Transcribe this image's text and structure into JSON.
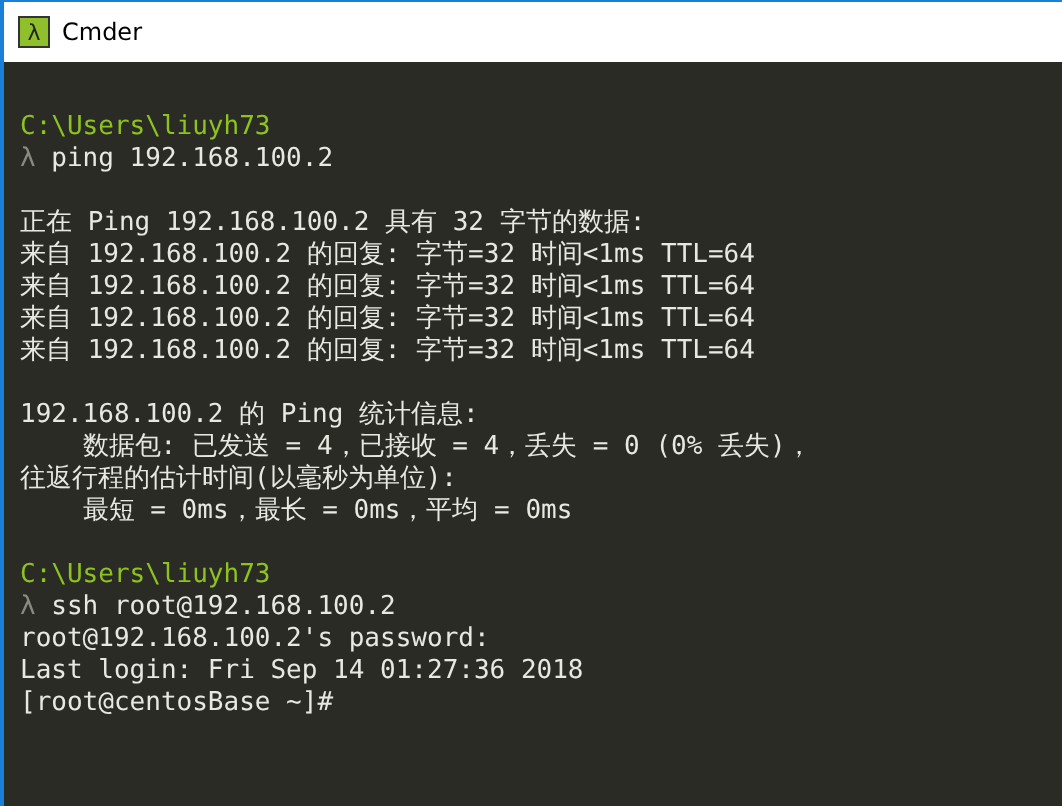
{
  "window": {
    "title": "Cmder",
    "icon_glyph": "λ"
  },
  "terminal": {
    "lines": [
      {
        "kind": "blank"
      },
      {
        "kind": "path",
        "text": "C:\\Users\\liuyh73"
      },
      {
        "kind": "prompt",
        "symbol": "λ",
        "text": "ping 192.168.100.2"
      },
      {
        "kind": "blank"
      },
      {
        "kind": "output",
        "text": "正在 Ping 192.168.100.2 具有 32 字节的数据:"
      },
      {
        "kind": "output",
        "text": "来自 192.168.100.2 的回复: 字节=32 时间<1ms TTL=64"
      },
      {
        "kind": "output",
        "text": "来自 192.168.100.2 的回复: 字节=32 时间<1ms TTL=64"
      },
      {
        "kind": "output",
        "text": "来自 192.168.100.2 的回复: 字节=32 时间<1ms TTL=64"
      },
      {
        "kind": "output",
        "text": "来自 192.168.100.2 的回复: 字节=32 时间<1ms TTL=64"
      },
      {
        "kind": "blank"
      },
      {
        "kind": "output",
        "text": "192.168.100.2 的 Ping 统计信息:"
      },
      {
        "kind": "output",
        "text": "    数据包: 已发送 = 4，已接收 = 4，丢失 = 0 (0% 丢失)，"
      },
      {
        "kind": "output",
        "text": "往返行程的估计时间(以毫秒为单位):"
      },
      {
        "kind": "output",
        "text": "    最短 = 0ms，最长 = 0ms，平均 = 0ms"
      },
      {
        "kind": "blank"
      },
      {
        "kind": "path",
        "text": "C:\\Users\\liuyh73"
      },
      {
        "kind": "prompt",
        "symbol": "λ",
        "text": "ssh root@192.168.100.2"
      },
      {
        "kind": "output",
        "text": "root@192.168.100.2's password:"
      },
      {
        "kind": "output",
        "text": "Last login: Fri Sep 14 01:27:36 2018"
      },
      {
        "kind": "output",
        "text": "[root@centosBase ~]#"
      }
    ]
  }
}
